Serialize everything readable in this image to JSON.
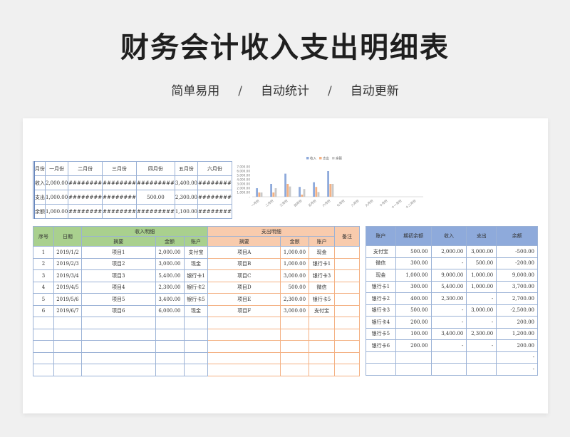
{
  "title": "财务会计收入支出明细表",
  "subtitle": {
    "a": "简单易用",
    "sep": "/",
    "b": "自动统计",
    "c": "自动更新"
  },
  "summary": {
    "headers": [
      "月份",
      "一月份",
      "二月份",
      "三月份",
      "四月份",
      "五月份",
      "六月份"
    ],
    "rows": [
      [
        "收入",
        "2,000.00",
        "########",
        "########",
        "#########",
        "3,400.00",
        "########"
      ],
      [
        "支出",
        "1,000.00",
        "########",
        "########",
        "500.00",
        "2,300.00",
        "########"
      ],
      [
        "余额",
        "1,000.00",
        "########",
        "########",
        "#########",
        "1,100.00",
        "########"
      ]
    ]
  },
  "chart_data": {
    "type": "bar",
    "categories": [
      "一月份",
      "二月份",
      "三月份",
      "四月份",
      "五月份",
      "六月份",
      "七月份",
      "八月份",
      "九月份",
      "十月份",
      "十一月份",
      "十二月份"
    ],
    "series": [
      {
        "name": "收入",
        "values": [
          2000,
          3000,
          5400,
          2300,
          3400,
          6000,
          0,
          0,
          0,
          0,
          0,
          0
        ]
      },
      {
        "name": "支出",
        "values": [
          1000,
          1000,
          3000,
          500,
          2300,
          3000,
          0,
          0,
          0,
          0,
          0,
          0
        ]
      },
      {
        "name": "余额",
        "values": [
          1000,
          2000,
          2400,
          1800,
          1100,
          3000,
          0,
          0,
          0,
          0,
          0,
          0
        ]
      }
    ],
    "yticks": [
      "7,000.00",
      "6,000.00",
      "5,000.00",
      "4,000.00",
      "3,000.00",
      "2,000.00",
      "1,000.00",
      "-"
    ],
    "ylim": [
      0,
      7000
    ],
    "colors": {
      "收入": "#8eaadb",
      "支出": "#f4b183",
      "余额": "#c9c9c9"
    },
    "legend": "top"
  },
  "main": {
    "h_seq": "序号",
    "h_date": "日期",
    "h_income": "收入明细",
    "h_expense": "支出明细",
    "h_note": "备注",
    "h_sub_summary": "摘要",
    "h_sub_amount": "金额",
    "h_sub_account": "账户",
    "rows": [
      {
        "seq": "1",
        "date": "2019/1/2",
        "in_sum": "项目1",
        "in_amt": "2,000.00",
        "in_acc": "支付宝",
        "ex_sum": "项目A",
        "ex_amt": "1,000.00",
        "ex_acc": "现金"
      },
      {
        "seq": "2",
        "date": "2019/2/3",
        "in_sum": "项目2",
        "in_amt": "3,000.00",
        "in_acc": "现金",
        "ex_sum": "项目B",
        "ex_amt": "1,000.00",
        "ex_acc": "银行卡1"
      },
      {
        "seq": "3",
        "date": "2019/3/4",
        "in_sum": "项目3",
        "in_amt": "5,400.00",
        "in_acc": "银行卡1",
        "ex_sum": "项目C",
        "ex_amt": "3,000.00",
        "ex_acc": "银行卡3"
      },
      {
        "seq": "4",
        "date": "2019/4/5",
        "in_sum": "项目4",
        "in_amt": "2,300.00",
        "in_acc": "银行卡2",
        "ex_sum": "项目D",
        "ex_amt": "500.00",
        "ex_acc": "微信"
      },
      {
        "seq": "5",
        "date": "2019/5/6",
        "in_sum": "项目5",
        "in_amt": "3,400.00",
        "in_acc": "银行卡5",
        "ex_sum": "项目E",
        "ex_amt": "2,300.00",
        "ex_acc": "银行卡5"
      },
      {
        "seq": "6",
        "date": "2019/6/7",
        "in_sum": "项目6",
        "in_amt": "6,000.00",
        "in_acc": "现金",
        "ex_sum": "项目F",
        "ex_amt": "3,000.00",
        "ex_acc": "支付宝"
      }
    ]
  },
  "accounts": {
    "headers": [
      "账户",
      "期初余额",
      "收入",
      "支出",
      "余额"
    ],
    "rows": [
      [
        "支付宝",
        "500.00",
        "2,000.00",
        "3,000.00",
        "-500.00"
      ],
      [
        "微信",
        "300.00",
        "-",
        "500.00",
        "-200.00"
      ],
      [
        "现金",
        "1,000.00",
        "9,000.00",
        "1,000.00",
        "9,000.00"
      ],
      [
        "银行卡1",
        "300.00",
        "5,400.00",
        "1,000.00",
        "3,700.00"
      ],
      [
        "银行卡2",
        "400.00",
        "2,300.00",
        "-",
        "2,700.00"
      ],
      [
        "银行卡3",
        "500.00",
        "-",
        "3,000.00",
        "-2,500.00"
      ],
      [
        "银行卡4",
        "200.00",
        "-",
        "-",
        "200.00"
      ],
      [
        "银行卡5",
        "100.00",
        "3,400.00",
        "2,300.00",
        "1,200.00"
      ],
      [
        "银行卡6",
        "200.00",
        "-",
        "-",
        "200.00"
      ],
      [
        "",
        "",
        "",
        "",
        "-"
      ],
      [
        "",
        "",
        "",
        "",
        "-"
      ]
    ]
  }
}
